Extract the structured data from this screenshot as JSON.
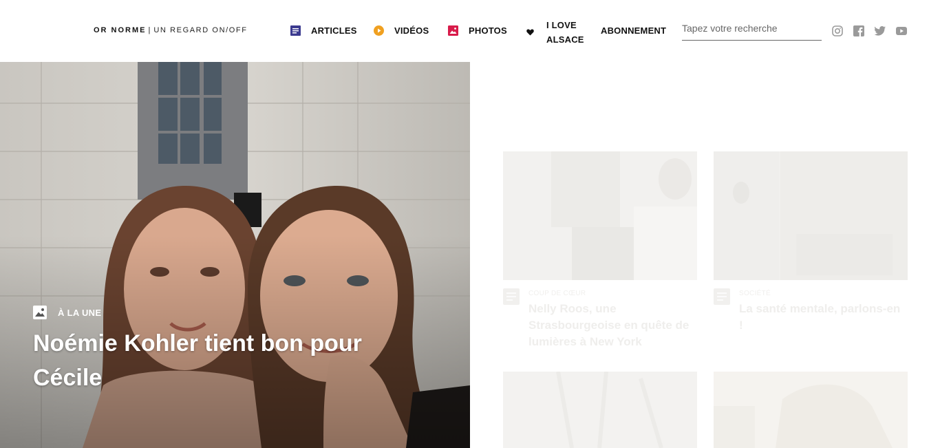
{
  "brand": {
    "name": "OR NORME",
    "separator": "|",
    "tagline": "UN REGARD ON/OFF"
  },
  "nav": {
    "articles": {
      "label": "ARTICLES",
      "icon": "article-icon"
    },
    "videos": {
      "label": "VIDÉOS",
      "icon": "play-icon"
    },
    "photos": {
      "label": "PHOTOS",
      "icon": "photo-icon"
    },
    "love": {
      "line1": "I LOVE",
      "line2": "ALSACE",
      "icon": "heart-icon"
    },
    "subscription": {
      "label": "ABONNEMENT"
    }
  },
  "search": {
    "placeholder": "Tapez votre recherche",
    "value": ""
  },
  "social": [
    "instagram-icon",
    "facebook-icon",
    "twitter-icon",
    "youtube-icon"
  ],
  "hero": {
    "category": "À LA UNE",
    "category_icon": "photo-icon",
    "title": "Noémie Kohler tient bon pour Cécile"
  },
  "cards": [
    {
      "meta": "COUP DE CŒUR",
      "title": "Nelly Roos, une Strasbourgeoise en quête de lumières à New York",
      "icon": "article-icon"
    },
    {
      "meta": "SOCIÉTÉ",
      "title": "La santé mentale, parlons-en !",
      "icon": "article-icon"
    }
  ],
  "colors": {
    "articles_icon": "#3b3a8f",
    "videos_icon": "#f0a020",
    "photos_icon": "#d81b4a",
    "text": "#111111",
    "faded_text": "#efeeec"
  }
}
